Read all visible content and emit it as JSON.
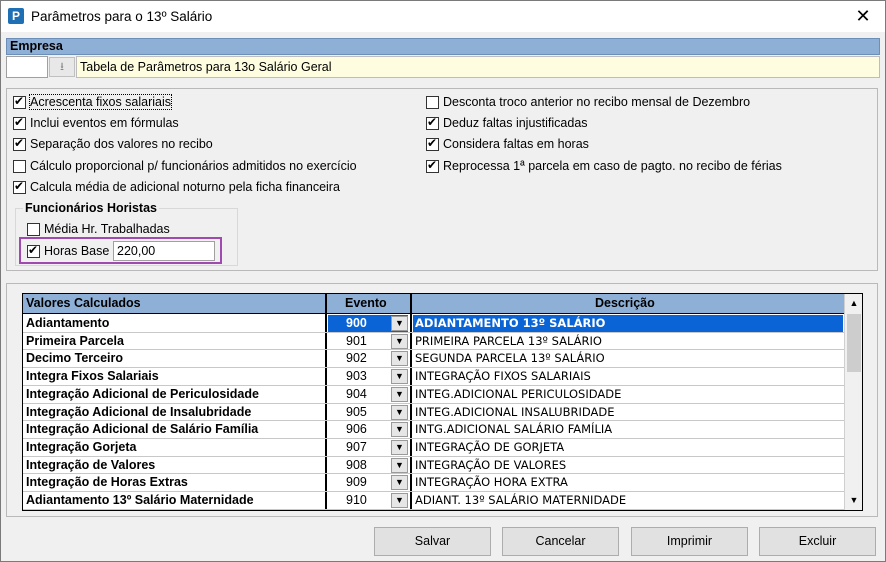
{
  "window": {
    "title": "Parâmetros para o 13º Salário",
    "icon_letter": "P",
    "close_label": "✕"
  },
  "empresa": {
    "header": "Empresa",
    "code": "",
    "name": "Tabela de Parâmetros para 13o Salário Geral",
    "lookup_icon": "download-arrow-icon"
  },
  "options_left": [
    {
      "label": "Acrescenta fixos salariais",
      "checked": true
    },
    {
      "label": "Inclui eventos em fórmulas",
      "checked": true
    },
    {
      "label": "Separação dos valores no recibo",
      "checked": true
    },
    {
      "label": "Cálculo proporcional p/ funcionários admitidos no exercício",
      "checked": false
    },
    {
      "label": "Calcula média de adicional noturno pela ficha financeira",
      "checked": true
    }
  ],
  "options_right": [
    {
      "label": "Desconta troco anterior no recibo mensal de Dezembro",
      "checked": false
    },
    {
      "label": "Deduz faltas injustificadas",
      "checked": true
    },
    {
      "label": "Considera faltas em horas",
      "checked": true
    },
    {
      "label": "Reprocessa 1ª parcela em caso de pagto. no recibo de férias",
      "checked": true
    }
  ],
  "horistas": {
    "title": "Funcionários Horistas",
    "media_label": "Média Hr. Trabalhadas",
    "media_checked": false,
    "horas_label": "Horas Base",
    "horas_checked": true,
    "horas_value": "220,00"
  },
  "grid": {
    "headers": {
      "name": "Valores Calculados",
      "event": "Evento",
      "desc": "Descrição"
    },
    "rows": [
      {
        "name": "Adiantamento",
        "event": "900",
        "desc": "ADIANTAMENTO 13º SALÁRIO",
        "selected": true
      },
      {
        "name": "Primeira Parcela",
        "event": "901",
        "desc": "PRIMEIRA PARCELA 13º SALÁRIO"
      },
      {
        "name": "Decimo Terceiro",
        "event": "902",
        "desc": "SEGUNDA PARCELA 13º SALÁRIO"
      },
      {
        "name": "Integra Fixos Salariais",
        "event": "903",
        "desc": "INTEGRAÇÃO FIXOS SALARIAIS"
      },
      {
        "name": "Integração Adicional de Periculosidade",
        "event": "904",
        "desc": "INTEG.ADICIONAL PERICULOSIDADE"
      },
      {
        "name": "Integração Adicional de Insalubridade",
        "event": "905",
        "desc": "INTEG.ADICIONAL INSALUBRIDADE"
      },
      {
        "name": "Integração Adicional de Salário Família",
        "event": "906",
        "desc": "INTG.ADICIONAL SALÁRIO FAMÍLIA"
      },
      {
        "name": "Integração Gorjeta",
        "event": "907",
        "desc": "INTEGRAÇÃO DE GORJETA"
      },
      {
        "name": "Integração de Valores",
        "event": "908",
        "desc": "INTEGRAÇÃO DE VALORES"
      },
      {
        "name": "Integração de Horas Extras",
        "event": "909",
        "desc": "INTEGRAÇÃO HORA EXTRA"
      },
      {
        "name": "Adiantamento 13º Salário Maternidade",
        "event": "910",
        "desc": "ADIANT. 13º SALÁRIO MATERNIDADE"
      }
    ]
  },
  "buttons": {
    "save": "Salvar",
    "cancel": "Cancelar",
    "print": "Imprimir",
    "delete": "Excluir"
  },
  "colors": {
    "header_blue": "#8fb0d6",
    "selection": "#0a64d6",
    "highlight_border": "#a04ab0",
    "empresa_bg": "#fffde0"
  }
}
